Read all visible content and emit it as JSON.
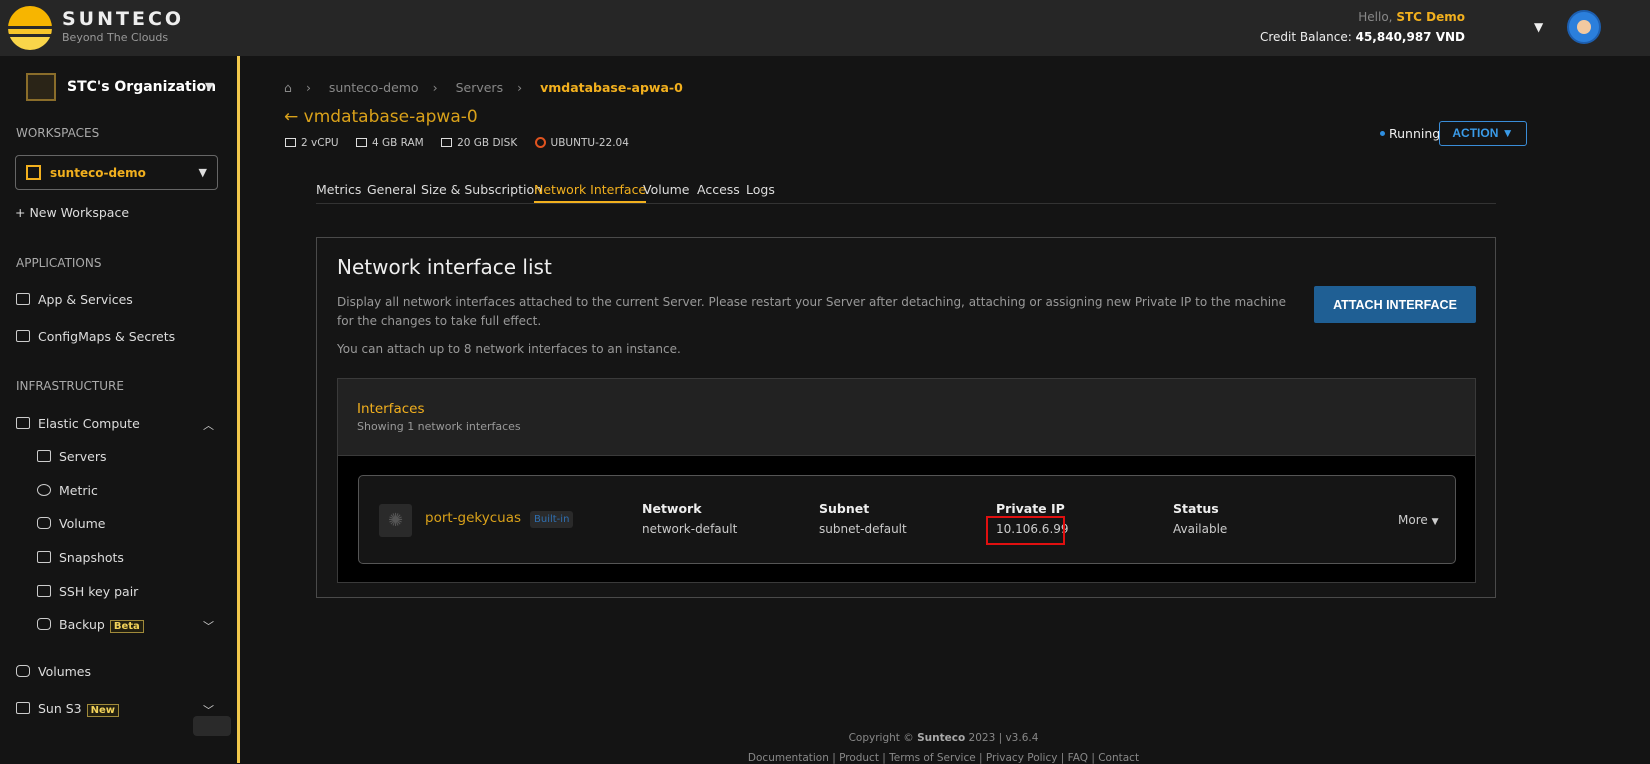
{
  "header": {
    "brand": "SUNTECO",
    "tagline": "Beyond The Clouds",
    "hello": "Hello,",
    "user": "STC Demo",
    "credit_label": "Credit Balance:",
    "credit_value": "45,840,987 VND"
  },
  "sidebar": {
    "org": "STC's Organization",
    "workspaces_title": "WORKSPACES",
    "workspace": "sunteco-demo",
    "new_workspace": "+ New Workspace",
    "applications_title": "APPLICATIONS",
    "app_services": "App & Services",
    "configmaps": "ConfigMaps & Secrets",
    "infrastructure_title": "INFRASTRUCTURE",
    "elastic_compute": "Elastic Compute",
    "sub": [
      "Servers",
      "Metric",
      "Volume",
      "Snapshots",
      "SSH key pair",
      "Backup"
    ],
    "backup_badge": "Beta",
    "volumes": "Volumes",
    "sun_s3": "Sun S3",
    "s3_badge": "New"
  },
  "breadcrumb": [
    "sunteco-demo",
    "Servers",
    "vmdatabase-apwa-0"
  ],
  "server": {
    "title": "vmdatabase-apwa-0",
    "cpu": "2 vCPU",
    "ram": "4 GB RAM",
    "disk": "20 GB DISK",
    "os": "UBUNTU-22.04",
    "status": "Running",
    "action": "ACTION"
  },
  "tabs": [
    "Metrics",
    "General",
    "Size & Subscription",
    "Network Interface",
    "Volume",
    "Access",
    "Logs"
  ],
  "card": {
    "title": "Network interface list",
    "desc": "Display all network interfaces attached to the current Server. Please restart your Server after detaching, attaching or assigning new Private IP to the machine for the changes to take full effect.",
    "limit": "You can attach up to 8 network interfaces to an instance.",
    "attach": "ATTACH INTERFACE"
  },
  "interfaces": {
    "title": "Interfaces",
    "subtitle": "Showing 1 network interfaces",
    "row": {
      "name": "port-gekycuas",
      "badge": "Built-in",
      "network_h": "Network",
      "network": "network-default",
      "subnet_h": "Subnet",
      "subnet": "subnet-default",
      "ip_h": "Private IP",
      "ip": "10.106.6.99",
      "status_h": "Status",
      "status": "Available",
      "more": "More"
    }
  },
  "footer": {
    "copyright_pre": "Copyright ©",
    "company": "Sunteco",
    "copyright_post": "2023 | v3.6.4",
    "links": "Documentation | Product | Terms of Service | Privacy Policy | FAQ | Contact"
  }
}
